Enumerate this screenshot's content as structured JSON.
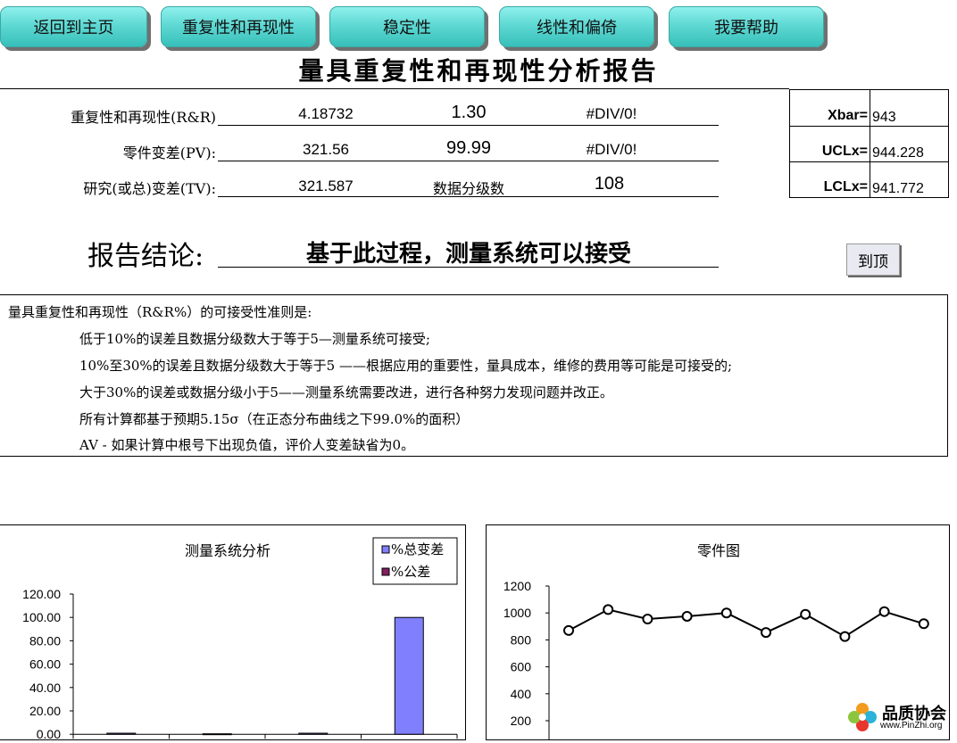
{
  "nav": [
    {
      "label": "返回到主页"
    },
    {
      "label": "重复性和再现性"
    },
    {
      "label": "稳定性"
    },
    {
      "label": "线性和偏倚"
    },
    {
      "label": "我要帮助"
    }
  ],
  "title": "量具重复性和再现性分析报告",
  "results": {
    "rr": {
      "label": "重复性和再现性(R&R)",
      "value": "4.18732",
      "percent": "1.30",
      "tol": "#DIV/0!"
    },
    "pv": {
      "label": "零件变差(PV):",
      "value": "321.56",
      "percent": "99.99",
      "tol": "#DIV/0!"
    },
    "tv": {
      "label": "研究(或总)变差(TV):",
      "value": "321.587",
      "ndc_label": "数据分级数",
      "ndc": "108"
    }
  },
  "control": [
    {
      "key": "Xbar=",
      "value": "943"
    },
    {
      "key": "UCLx=",
      "value": "944.228"
    },
    {
      "key": "LCLx=",
      "value": "941.772"
    }
  ],
  "conclusion": {
    "label": "报告结论:",
    "text": "基于此过程，测量系统可以接受"
  },
  "top_button": "到顶",
  "criteria": {
    "heading": "量具重复性和再现性（R&R%）的可接受性准则是:",
    "lines": [
      "低于10%的误差且数据分级数大于等于5—测量系统可接受;",
      "10%至30%的误差且数据分级数大于等于5 ——根据应用的重要性，量具成本，维修的费用等可能是可接受的;",
      "大于30%的误差或数据分级小于5——测量系统需要改进，进行各种努力发现问题并改正。",
      "所有计算都基于预期5.15σ（在正态分布曲线之下99.0%的面积）",
      "AV - 如果计算中根号下出现负值，评价人变差缺省为0。"
    ]
  },
  "chart_data": [
    {
      "type": "bar",
      "title": "测量系统分析",
      "ylim": [
        0,
        120
      ],
      "yticks": [
        "0.00",
        "20.00",
        "40.00",
        "60.00",
        "80.00",
        "100.00",
        "120.00"
      ],
      "categories": [
        "",
        "",
        "",
        ""
      ],
      "series": [
        {
          "name": "%总变差",
          "color": "#8080ff",
          "values": [
            0.9,
            0.4,
            0.9,
            99.99
          ]
        },
        {
          "name": "%公差",
          "color": "#802060",
          "values": [
            0,
            0,
            0,
            0
          ]
        }
      ],
      "legend": "top-right"
    },
    {
      "type": "line",
      "title": "零件图",
      "ylim": [
        0,
        1200
      ],
      "yticks": [
        "200",
        "400",
        "600",
        "800",
        "1000",
        "1200"
      ],
      "values": [
        870,
        1025,
        955,
        975,
        1000,
        855,
        990,
        825,
        1010,
        920
      ]
    }
  ],
  "watermark": {
    "name": "品质协会",
    "url": "www.PinZhi.org"
  }
}
